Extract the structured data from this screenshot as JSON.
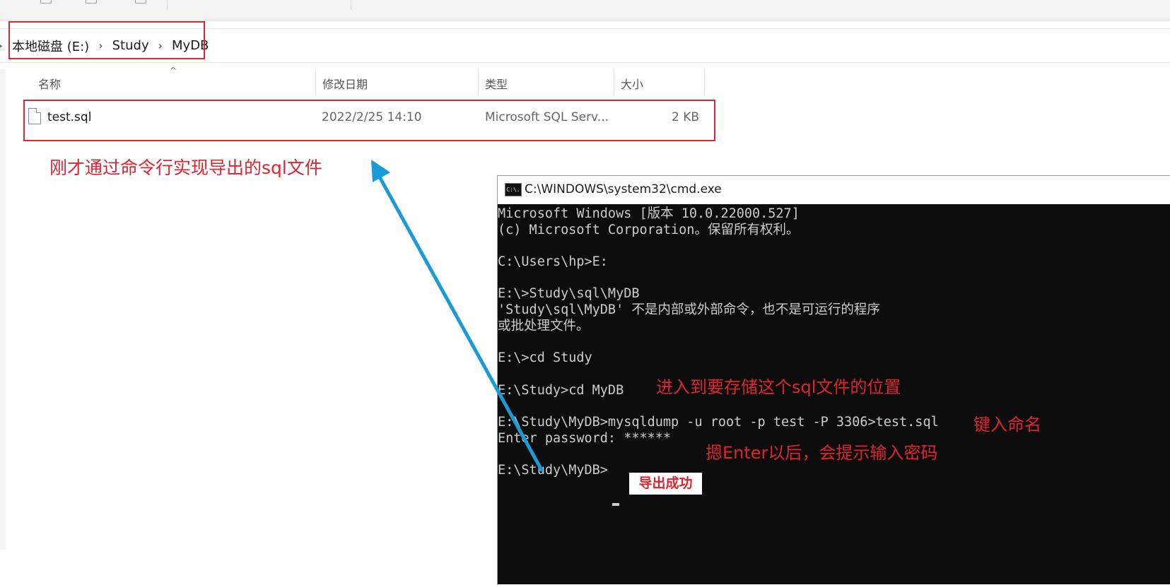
{
  "explorer": {
    "breadcrumb": {
      "items": [
        "本地磁盘 (E:)",
        "Study",
        "MyDB"
      ]
    },
    "columns": [
      {
        "label": "名称"
      },
      {
        "label": "修改日期"
      },
      {
        "label": "类型"
      },
      {
        "label": "大小"
      }
    ],
    "files": [
      {
        "name": "test.sql",
        "modified": "2022/2/25 14:10",
        "type": "Microsoft SQL Serv...",
        "size": "2 KB",
        "icon": "sql-file-icon"
      }
    ]
  },
  "cmd": {
    "title": "C:\\WINDOWS\\system32\\cmd.exe",
    "icon_text": "C:\\.",
    "lines": [
      "Microsoft Windows [版本 10.0.22000.527]",
      "(c) Microsoft Corporation。保留所有权利。",
      "",
      "C:\\Users\\hp>E:",
      "",
      "E:\\>Study\\sql\\MyDB",
      "'Study\\sql\\MyDB' 不是内部或外部命令，也不是可运行的程序",
      "或批处理文件。",
      "",
      "E:\\>cd Study",
      "",
      "E:\\Study>cd MyDB",
      "",
      "E:\\Study\\MyDB>mysqldump -u root -p test -P 3306>test.sql",
      "Enter password: ******",
      "",
      "E:\\Study\\MyDB>"
    ]
  },
  "annotations": {
    "exported_file_note": "刚才通过命令行实现导出的sql文件",
    "enter_location_note": "进入到要存储这个sql文件的位置",
    "type_command_note": "键入命名",
    "password_note": "摁Enter以后，会提示输入密码",
    "success_label": "导出成功",
    "highlight_color": "#d62b34",
    "arrow_color": "#1a9ad6"
  }
}
